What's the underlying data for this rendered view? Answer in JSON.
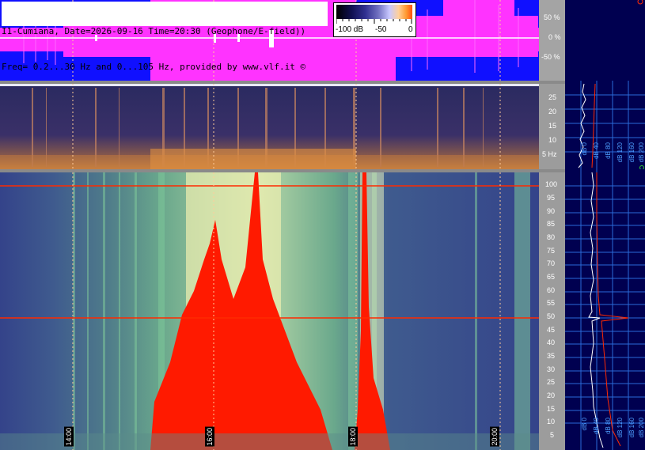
{
  "header": {
    "line1": "I1-Cumiana, Date=2026-09-16 Time=20:30 (Geophone/E-field))",
    "line2": "Freq= 0.2...30 Hz and 0...105 Hz, provided by www.vlf.it ©"
  },
  "colorbar": {
    "labels": [
      "-100 dB",
      "-50",
      "0"
    ]
  },
  "waveform_scale": {
    "labels": [
      "50 %",
      "0 %",
      "-50 %"
    ]
  },
  "low_band_scale": {
    "labels": [
      "25",
      "20",
      "15",
      "10",
      "5 Hz"
    ]
  },
  "high_band_scale": {
    "labels": [
      "100",
      "95",
      "90",
      "85",
      "80",
      "75",
      "70",
      "65",
      "60",
      "55",
      "50",
      "45",
      "40",
      "35",
      "30",
      "25",
      "20",
      "15",
      "10",
      "5"
    ]
  },
  "time_axis": {
    "labels": [
      "14:00",
      "16:00",
      "18:00",
      "20:00"
    ]
  },
  "right_low_labels": [
    "dB 0",
    "dB 40",
    "dB 80",
    "dB 120",
    "dB 160",
    "dB 200"
  ],
  "right_high_labels": [
    "dB 0",
    "dB 40",
    "dB 80",
    "dB 120",
    "dB 160",
    "dB 200"
  ],
  "colors": {
    "waveform_bg": "#1010ff",
    "waveform_signal": "#ff33ff",
    "spectro_low_bg": "#1b1f55",
    "spectro_high_bg": "#3a4a8c",
    "hot": "#ff1a00",
    "panel_right": "#000050"
  }
}
